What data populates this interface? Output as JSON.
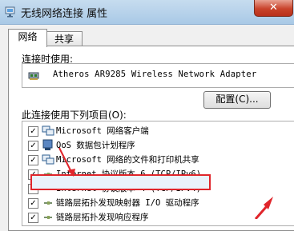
{
  "window": {
    "title": "无线网络连接 属性",
    "close_label": "✕"
  },
  "tabs": [
    {
      "label": "网络",
      "active": true
    },
    {
      "label": "共享",
      "active": false
    }
  ],
  "connect_using": {
    "label": "连接时使用:",
    "adapter": "Atheros AR9285 Wireless Network Adapter",
    "configure_button": "配置(C)..."
  },
  "items_section": {
    "label": "此连接使用下列项目(O):",
    "items": [
      {
        "text": "Microsoft 网络客户端",
        "checked": true,
        "icon": "network-client-icon"
      },
      {
        "text": "QoS 数据包计划程序",
        "checked": true,
        "icon": "qos-icon"
      },
      {
        "text": "Microsoft 网络的文件和打印机共享",
        "checked": true,
        "icon": "file-share-icon"
      },
      {
        "text": "Internet 协议版本 6 (TCP/IPv6)",
        "checked": true,
        "icon": "protocol-icon"
      },
      {
        "text": "Internet 协议版本 4 (TCP/IPv4)",
        "checked": true,
        "icon": "protocol-icon",
        "selected": true
      },
      {
        "text": "链路层拓扑发现映射器 I/O 驱动程序",
        "checked": true,
        "icon": "protocol-icon"
      },
      {
        "text": "链路层拓扑发现响应程序",
        "checked": true,
        "icon": "protocol-icon"
      }
    ]
  },
  "colors": {
    "highlight_border": "#e0252b",
    "arrow": "#e0252b",
    "titlebar": "#b9d3ea"
  }
}
